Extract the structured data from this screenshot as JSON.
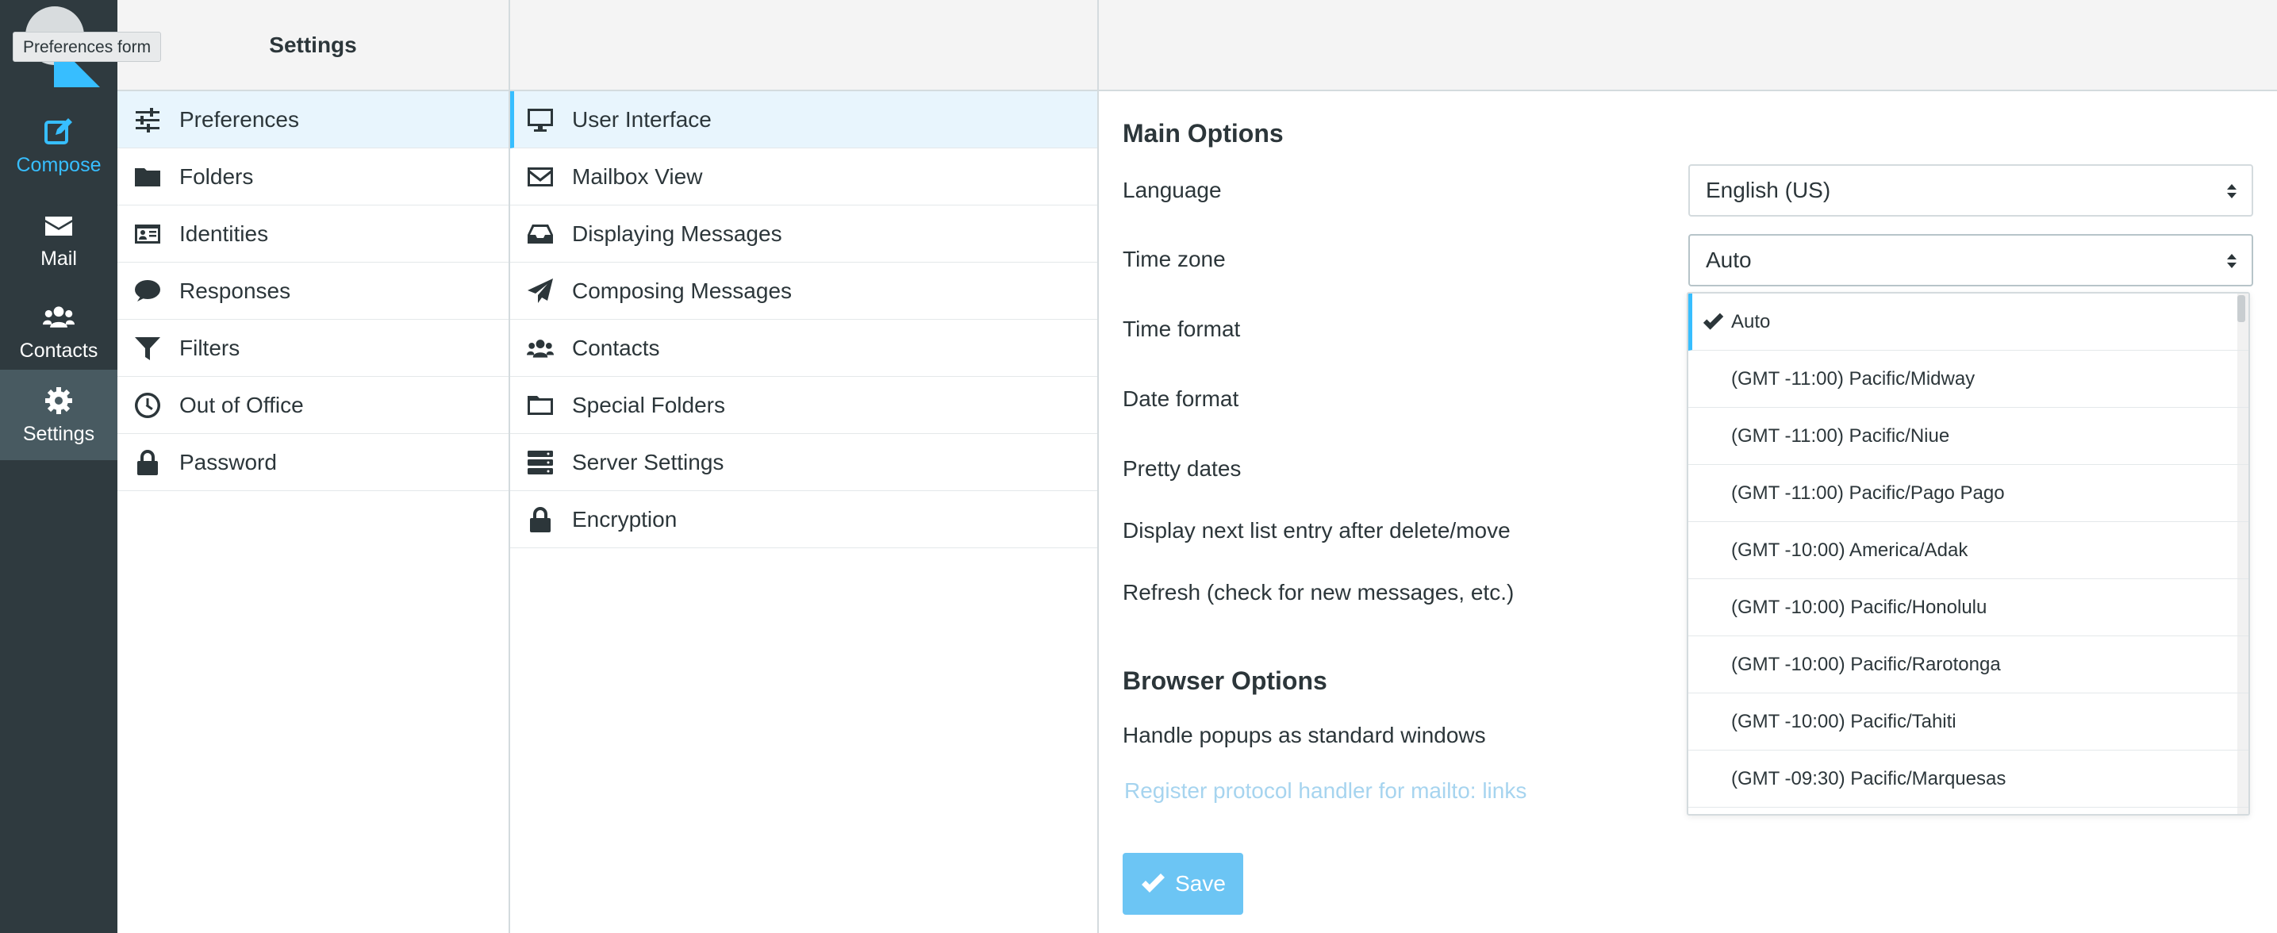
{
  "tooltip": "Preferences form",
  "taskbar": {
    "items": [
      {
        "label": "Compose",
        "icon": "edit-icon"
      },
      {
        "label": "Mail",
        "icon": "envelope-icon"
      },
      {
        "label": "Contacts",
        "icon": "users-icon"
      },
      {
        "label": "Settings",
        "icon": "gear-icon"
      }
    ]
  },
  "settings_nav": {
    "title": "Settings",
    "items": [
      {
        "label": "Preferences",
        "icon": "sliders-icon"
      },
      {
        "label": "Folders",
        "icon": "folder-icon"
      },
      {
        "label": "Identities",
        "icon": "id-card-icon"
      },
      {
        "label": "Responses",
        "icon": "comment-icon"
      },
      {
        "label": "Filters",
        "icon": "filter-icon"
      },
      {
        "label": "Out of Office",
        "icon": "clock-icon"
      },
      {
        "label": "Password",
        "icon": "lock-icon"
      }
    ]
  },
  "sections": {
    "items": [
      {
        "label": "User Interface",
        "icon": "monitor-icon"
      },
      {
        "label": "Mailbox View",
        "icon": "envelope-outline-icon"
      },
      {
        "label": "Displaying Messages",
        "icon": "inbox-icon"
      },
      {
        "label": "Composing Messages",
        "icon": "paper-plane-icon"
      },
      {
        "label": "Contacts",
        "icon": "users-icon"
      },
      {
        "label": "Special Folders",
        "icon": "folder-outline-icon"
      },
      {
        "label": "Server Settings",
        "icon": "server-icon"
      },
      {
        "label": "Encryption",
        "icon": "lock-icon"
      }
    ]
  },
  "form": {
    "main_options_title": "Main Options",
    "language_label": "Language",
    "language_value": "English (US)",
    "timezone_label": "Time zone",
    "timezone_value": "Auto",
    "time_format_label": "Time format",
    "date_format_label": "Date format",
    "pretty_dates_label": "Pretty dates",
    "display_next_label": "Display next list entry after delete/move",
    "refresh_label": "Refresh (check for new messages, etc.)",
    "browser_options_title": "Browser Options",
    "popups_label": "Handle popups as standard windows",
    "register_handler_label": "Register protocol handler for mailto: links",
    "save_label": "Save"
  },
  "timezone_options": [
    "Auto",
    "(GMT -11:00) Pacific/Midway",
    "(GMT -11:00) Pacific/Niue",
    "(GMT -11:00) Pacific/Pago Pago",
    "(GMT -10:00) America/Adak",
    "(GMT -10:00) Pacific/Honolulu",
    "(GMT -10:00) Pacific/Rarotonga",
    "(GMT -10:00) Pacific/Tahiti",
    "(GMT -09:30) Pacific/Marquesas"
  ],
  "colors": {
    "accent": "#37beff",
    "taskbar_bg": "#2f3a3f",
    "active_row_bg": "#e8f5fd"
  }
}
